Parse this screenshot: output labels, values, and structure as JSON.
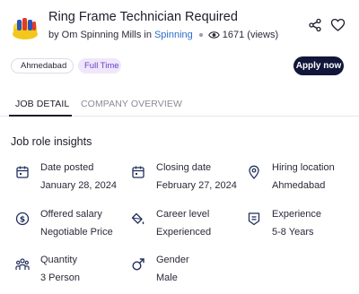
{
  "job": {
    "title": "Ring Frame Technician Required",
    "by_prefix": "by Om Spinning Mills in",
    "category": "Spinning",
    "views": "1671 (views)"
  },
  "chips": {
    "location": "Ahmedabad",
    "job_type": "Full Time"
  },
  "actions": {
    "apply_label": "Apply now"
  },
  "tabs": [
    {
      "label": "JOB DETAIL",
      "active": true
    },
    {
      "label": "COMPANY OVERVIEW",
      "active": false
    }
  ],
  "insights": {
    "title": "Job role insights",
    "items": [
      {
        "icon": "calendar-icon",
        "label": "Date posted",
        "value": "January 28, 2024"
      },
      {
        "icon": "calendar-icon",
        "label": "Closing date",
        "value": "February 27, 2024"
      },
      {
        "icon": "location-pin-icon",
        "label": "Hiring location",
        "value": "Ahmedabad"
      },
      {
        "icon": "dollar-coin-icon",
        "label": "Offered salary",
        "value": "Negotiable Price"
      },
      {
        "icon": "paint-bucket-icon",
        "label": "Career level",
        "value": "Experienced"
      },
      {
        "icon": "badge-icon",
        "label": "Experience",
        "value": "5-8 Years"
      },
      {
        "icon": "people-icon",
        "label": "Quantity",
        "value": "3 Person"
      },
      {
        "icon": "gender-male-icon",
        "label": "Gender",
        "value": "Male"
      }
    ]
  },
  "colors": {
    "accent_link": "#2d6ec9",
    "apply_button": "#11163a",
    "chip_purple_bg": "#efe7fb",
    "chip_purple_text": "#6d3fc4",
    "icon_navy": "#22305c"
  }
}
